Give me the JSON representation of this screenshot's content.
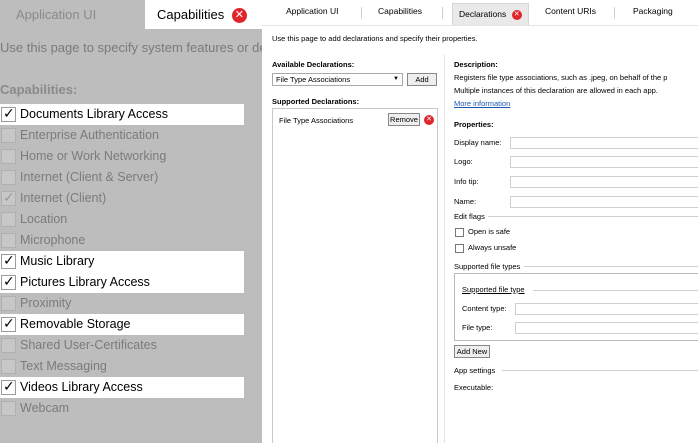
{
  "left": {
    "tabs": [
      {
        "label": "Application UI",
        "active": false
      },
      {
        "label": "Capabilities",
        "active": true
      }
    ],
    "close_glyph": "✕",
    "description": "Use this page to specify system features or devices",
    "capabilities_heading": "Capabilities:",
    "checkmark": "✓",
    "capabilities": [
      {
        "label": "Documents Library Access",
        "checked": true,
        "highlighted": true
      },
      {
        "label": "Enterprise Authentication",
        "checked": false,
        "highlighted": false
      },
      {
        "label": "Home or Work Networking",
        "checked": false,
        "highlighted": false
      },
      {
        "label": "Internet (Client & Server)",
        "checked": false,
        "highlighted": false
      },
      {
        "label": "Internet (Client)",
        "checked": true,
        "highlighted": false
      },
      {
        "label": "Location",
        "checked": false,
        "highlighted": false
      },
      {
        "label": "Microphone",
        "checked": false,
        "highlighted": false
      },
      {
        "label": "Music Library",
        "checked": true,
        "highlighted": true
      },
      {
        "label": "Pictures Library Access",
        "checked": true,
        "highlighted": true
      },
      {
        "label": "Proximity",
        "checked": false,
        "highlighted": false
      },
      {
        "label": "Removable Storage",
        "checked": true,
        "highlighted": true
      },
      {
        "label": "Shared User-Certificates",
        "checked": false,
        "highlighted": false
      },
      {
        "label": "Text Messaging",
        "checked": false,
        "highlighted": false
      },
      {
        "label": "Videos Library Access",
        "checked": true,
        "highlighted": true
      },
      {
        "label": "Webcam",
        "checked": false,
        "highlighted": false
      }
    ]
  },
  "right": {
    "tabs": [
      {
        "label": "Application UI",
        "active": false
      },
      {
        "label": "Capabilities",
        "active": false
      },
      {
        "label": "Declarations",
        "active": true
      },
      {
        "label": "Content URIs",
        "active": false
      },
      {
        "label": "Packaging",
        "active": false
      }
    ],
    "close_glyph": "✕",
    "intro": "Use this page to add declarations and specify their properties.",
    "available_declarations": {
      "heading": "Available Declarations:",
      "selected": "File Type Associations",
      "add_label": "Add"
    },
    "supported_declarations": {
      "heading": "Supported Declarations:",
      "items": [
        {
          "label": "File Type Associations",
          "remove_label": "Remove"
        }
      ]
    },
    "description": {
      "heading": "Description:",
      "line1": "Registers file type associations, such as .jpeg, on behalf of the p",
      "line2": "Multiple instances of this declaration are allowed in each app.",
      "more_info": "More information"
    },
    "properties": {
      "heading": "Properties:",
      "display_name_label": "Display name:",
      "logo_label": "Logo:",
      "info_tip_label": "Info tip:",
      "name_label": "Name:",
      "edit_flags_label": "Edit flags",
      "open_is_safe_label": "Open is safe",
      "always_unsafe_label": "Always unsafe",
      "supported_file_types_label": "Supported file types",
      "supported_file_type_label": "Supported file type",
      "content_type_label": "Content type:",
      "file_type_label": "File type:",
      "add_new_label": "Add New",
      "app_settings_label": "App settings",
      "executable_label": "Executable:"
    }
  }
}
